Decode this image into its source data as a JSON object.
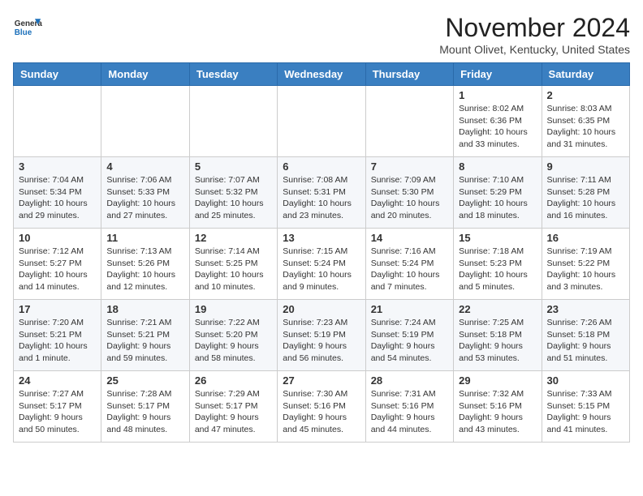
{
  "header": {
    "logo": {
      "general": "General",
      "blue": "Blue"
    },
    "title": "November 2024",
    "location": "Mount Olivet, Kentucky, United States"
  },
  "calendar": {
    "days_of_week": [
      "Sunday",
      "Monday",
      "Tuesday",
      "Wednesday",
      "Thursday",
      "Friday",
      "Saturday"
    ],
    "weeks": [
      [
        {
          "day": "",
          "info": ""
        },
        {
          "day": "",
          "info": ""
        },
        {
          "day": "",
          "info": ""
        },
        {
          "day": "",
          "info": ""
        },
        {
          "day": "",
          "info": ""
        },
        {
          "day": "1",
          "info": "Sunrise: 8:02 AM\nSunset: 6:36 PM\nDaylight: 10 hours and 33 minutes."
        },
        {
          "day": "2",
          "info": "Sunrise: 8:03 AM\nSunset: 6:35 PM\nDaylight: 10 hours and 31 minutes."
        }
      ],
      [
        {
          "day": "3",
          "info": "Sunrise: 7:04 AM\nSunset: 5:34 PM\nDaylight: 10 hours and 29 minutes."
        },
        {
          "day": "4",
          "info": "Sunrise: 7:06 AM\nSunset: 5:33 PM\nDaylight: 10 hours and 27 minutes."
        },
        {
          "day": "5",
          "info": "Sunrise: 7:07 AM\nSunset: 5:32 PM\nDaylight: 10 hours and 25 minutes."
        },
        {
          "day": "6",
          "info": "Sunrise: 7:08 AM\nSunset: 5:31 PM\nDaylight: 10 hours and 23 minutes."
        },
        {
          "day": "7",
          "info": "Sunrise: 7:09 AM\nSunset: 5:30 PM\nDaylight: 10 hours and 20 minutes."
        },
        {
          "day": "8",
          "info": "Sunrise: 7:10 AM\nSunset: 5:29 PM\nDaylight: 10 hours and 18 minutes."
        },
        {
          "day": "9",
          "info": "Sunrise: 7:11 AM\nSunset: 5:28 PM\nDaylight: 10 hours and 16 minutes."
        }
      ],
      [
        {
          "day": "10",
          "info": "Sunrise: 7:12 AM\nSunset: 5:27 PM\nDaylight: 10 hours and 14 minutes."
        },
        {
          "day": "11",
          "info": "Sunrise: 7:13 AM\nSunset: 5:26 PM\nDaylight: 10 hours and 12 minutes."
        },
        {
          "day": "12",
          "info": "Sunrise: 7:14 AM\nSunset: 5:25 PM\nDaylight: 10 hours and 10 minutes."
        },
        {
          "day": "13",
          "info": "Sunrise: 7:15 AM\nSunset: 5:24 PM\nDaylight: 10 hours and 9 minutes."
        },
        {
          "day": "14",
          "info": "Sunrise: 7:16 AM\nSunset: 5:24 PM\nDaylight: 10 hours and 7 minutes."
        },
        {
          "day": "15",
          "info": "Sunrise: 7:18 AM\nSunset: 5:23 PM\nDaylight: 10 hours and 5 minutes."
        },
        {
          "day": "16",
          "info": "Sunrise: 7:19 AM\nSunset: 5:22 PM\nDaylight: 10 hours and 3 minutes."
        }
      ],
      [
        {
          "day": "17",
          "info": "Sunrise: 7:20 AM\nSunset: 5:21 PM\nDaylight: 10 hours and 1 minute."
        },
        {
          "day": "18",
          "info": "Sunrise: 7:21 AM\nSunset: 5:21 PM\nDaylight: 9 hours and 59 minutes."
        },
        {
          "day": "19",
          "info": "Sunrise: 7:22 AM\nSunset: 5:20 PM\nDaylight: 9 hours and 58 minutes."
        },
        {
          "day": "20",
          "info": "Sunrise: 7:23 AM\nSunset: 5:19 PM\nDaylight: 9 hours and 56 minutes."
        },
        {
          "day": "21",
          "info": "Sunrise: 7:24 AM\nSunset: 5:19 PM\nDaylight: 9 hours and 54 minutes."
        },
        {
          "day": "22",
          "info": "Sunrise: 7:25 AM\nSunset: 5:18 PM\nDaylight: 9 hours and 53 minutes."
        },
        {
          "day": "23",
          "info": "Sunrise: 7:26 AM\nSunset: 5:18 PM\nDaylight: 9 hours and 51 minutes."
        }
      ],
      [
        {
          "day": "24",
          "info": "Sunrise: 7:27 AM\nSunset: 5:17 PM\nDaylight: 9 hours and 50 minutes."
        },
        {
          "day": "25",
          "info": "Sunrise: 7:28 AM\nSunset: 5:17 PM\nDaylight: 9 hours and 48 minutes."
        },
        {
          "day": "26",
          "info": "Sunrise: 7:29 AM\nSunset: 5:17 PM\nDaylight: 9 hours and 47 minutes."
        },
        {
          "day": "27",
          "info": "Sunrise: 7:30 AM\nSunset: 5:16 PM\nDaylight: 9 hours and 45 minutes."
        },
        {
          "day": "28",
          "info": "Sunrise: 7:31 AM\nSunset: 5:16 PM\nDaylight: 9 hours and 44 minutes."
        },
        {
          "day": "29",
          "info": "Sunrise: 7:32 AM\nSunset: 5:16 PM\nDaylight: 9 hours and 43 minutes."
        },
        {
          "day": "30",
          "info": "Sunrise: 7:33 AM\nSunset: 5:15 PM\nDaylight: 9 hours and 41 minutes."
        }
      ]
    ]
  }
}
